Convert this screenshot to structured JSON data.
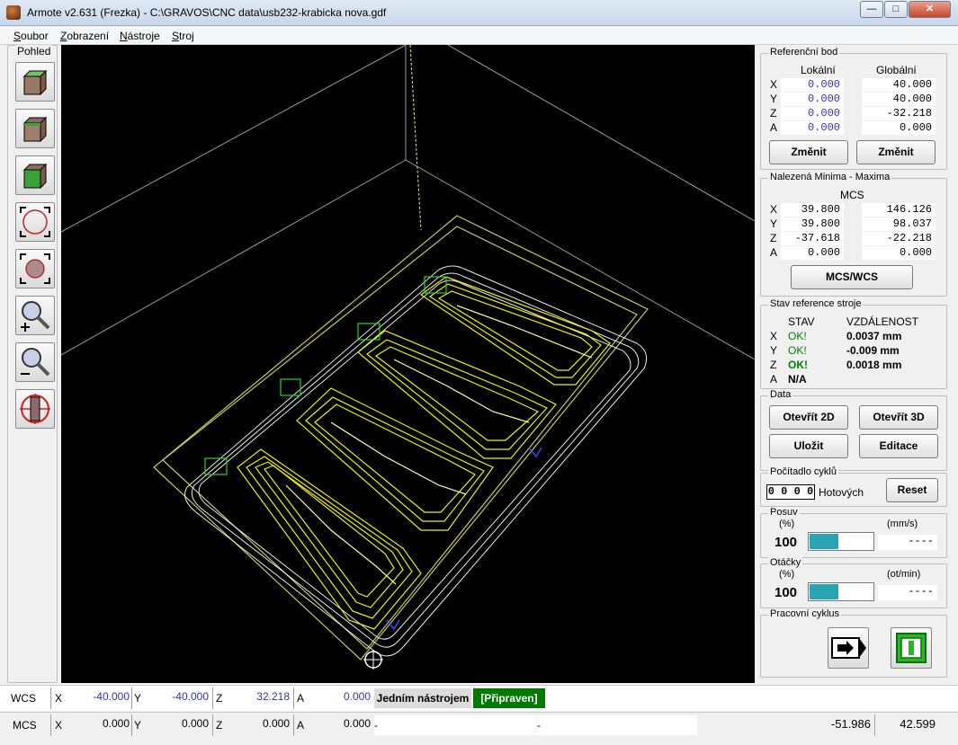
{
  "window": {
    "title": "Armote v2.631 (Frezka) - C:\\GRAVOS\\CNC data\\usb232-krabicka nova.gdf"
  },
  "menu": [
    {
      "label": "Soubor",
      "accel": "S"
    },
    {
      "label": "Zobrazení",
      "accel": "Z"
    },
    {
      "label": "Nástroje",
      "accel": "N"
    },
    {
      "label": "Stroj",
      "accel": "S"
    }
  ],
  "left_panel": {
    "label": "Pohled",
    "tools": [
      "cube-front-icon",
      "cube-top-icon",
      "cube-side-icon",
      "zoom-fit-icon",
      "zoom-window-icon",
      "zoom-in-icon",
      "zoom-out-icon",
      "target-icon"
    ]
  },
  "ref_point": {
    "label": "Referenční bod",
    "col_local": "Lokální",
    "col_global": "Globální",
    "rows": [
      {
        "axis": "X",
        "local": "0.000",
        "global": "40.000"
      },
      {
        "axis": "Y",
        "local": "0.000",
        "global": "40.000"
      },
      {
        "axis": "Z",
        "local": "0.000",
        "global": "-32.218"
      },
      {
        "axis": "A",
        "local": "0.000",
        "global": "0.000"
      }
    ],
    "btn_local": "Změnit",
    "btn_global": "Změnit"
  },
  "minmax": {
    "label": "Nalezená Minima - Maxima",
    "header": "MCS",
    "rows": [
      {
        "axis": "X",
        "min": "39.800",
        "max": "146.126"
      },
      {
        "axis": "Y",
        "min": "39.800",
        "max": "98.037"
      },
      {
        "axis": "Z",
        "min": "-37.618",
        "max": "-22.218"
      },
      {
        "axis": "A",
        "min": "0.000",
        "max": "0.000"
      }
    ],
    "btn": "MCS/WCS"
  },
  "machine_ref": {
    "label": "Stav reference stroje",
    "col_state": "STAV",
    "col_dist": "VZDÁLENOST",
    "rows": [
      {
        "axis": "X",
        "state": "OK!",
        "dist": "0.0037 mm"
      },
      {
        "axis": "Y",
        "state": "OK!",
        "dist": "-0.009 mm"
      },
      {
        "axis": "Z",
        "state": "OK!",
        "dist": "0.0018 mm"
      },
      {
        "axis": "A",
        "state": "N/A",
        "dist": ""
      }
    ]
  },
  "data_group": {
    "label": "Data",
    "open2d": "Otevřít 2D",
    "open3d": "Otevřít 3D",
    "save": "Uložit",
    "edit": "Editace"
  },
  "cycle_counter": {
    "label": "Počítadlo cyklů",
    "count": "0 0 0 0",
    "done_label": "Hotových",
    "reset": "Reset"
  },
  "feed": {
    "label": "Posuv",
    "unit_pct": "(%)",
    "unit_rate": "(mm/s)",
    "value": "100",
    "fill_pct": 45,
    "rate": "----"
  },
  "spindle": {
    "label": "Otáčky",
    "unit_pct": "(%)",
    "unit_rate": "(ot/min)",
    "value": "100",
    "fill_pct": 45,
    "rate": "----"
  },
  "work_cycle": {
    "label": "Pracovní cyklus"
  },
  "status": {
    "wcs": {
      "label": "WCS",
      "x": "-40.000",
      "y": "-40.000",
      "z": "32.218",
      "a": "0.000",
      "mode": "Jedním nástrojem",
      "state": "[Připraven]"
    },
    "mcs": {
      "label": "MCS",
      "x": "0.000",
      "y": "0.000",
      "z": "0.000",
      "a": "0.000",
      "dash1": "-",
      "dash2": "-",
      "coord1": "-51.986",
      "coord2": "42.599"
    },
    "axis_x": "X",
    "axis_y": "Y",
    "axis_z": "Z",
    "axis_a": "A"
  },
  "colors": {
    "accent": "#2aa3b2",
    "ok_green": "#008000",
    "ready_bg": "#007a00",
    "toolpath": "#f0f000"
  }
}
